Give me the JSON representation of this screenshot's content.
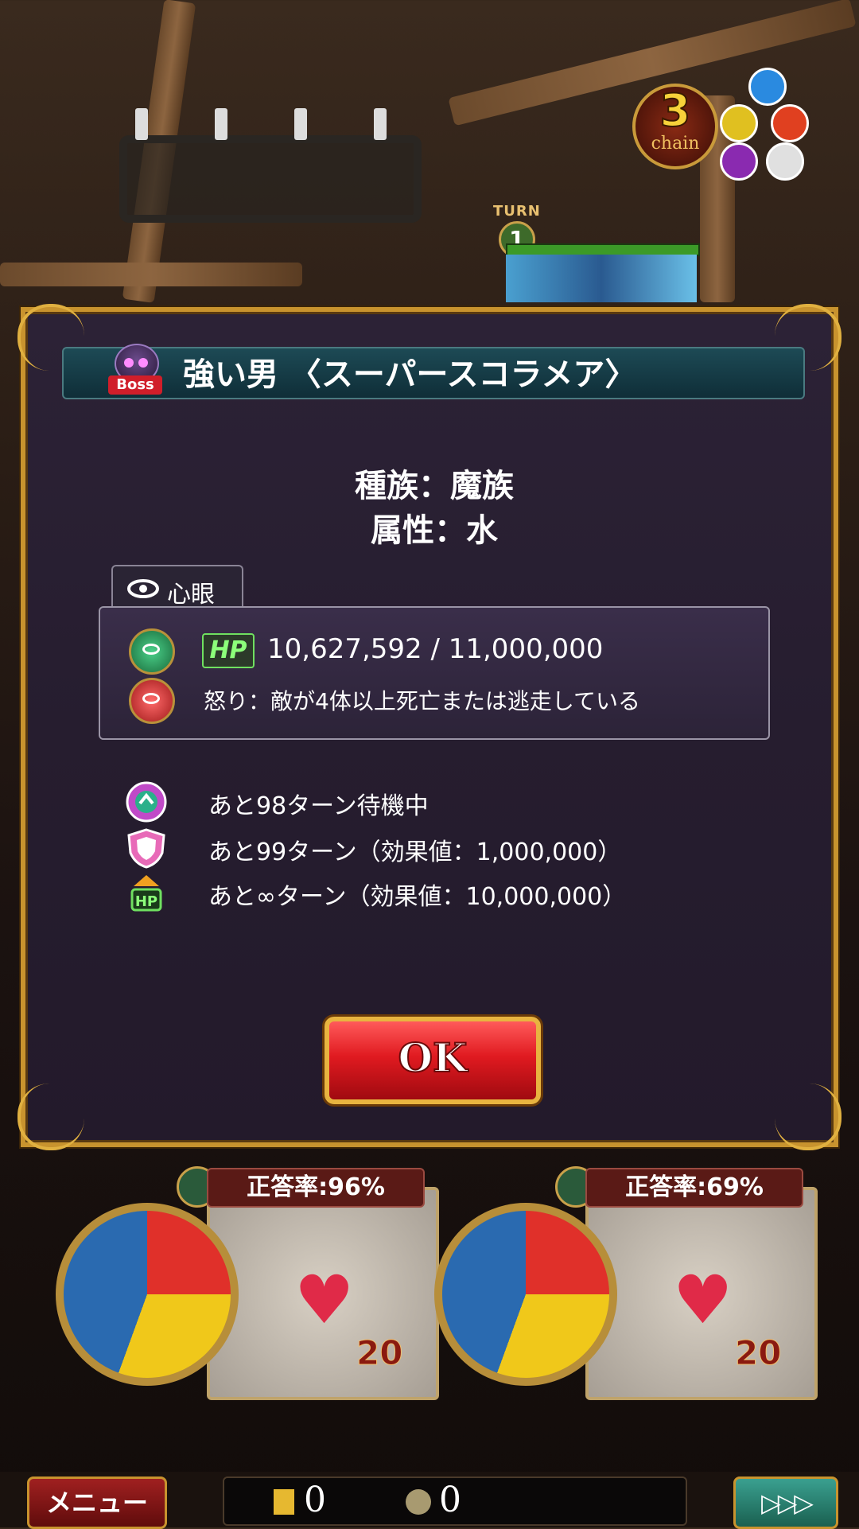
{
  "hud": {
    "chain_count": "3",
    "chain_label": "chain",
    "turn_label": "TURN",
    "turn_number": "1"
  },
  "dialog": {
    "boss_tag": "Boss",
    "title": "強い男 〈スーパースコラメア〉",
    "race": "種族：魔族",
    "attribute": "属性：水",
    "tab_label": "心眼",
    "hp_badge": "HP",
    "hp_text": "10,627,592 / 11,000,000",
    "rage_text": "怒り：敵が4体以上死亡または逃走している",
    "statuses": [
      {
        "icon": "swap-arrow-icon",
        "text": "あと98ターン待機中"
      },
      {
        "icon": "shield-icon",
        "text": "あと99ターン（効果値：1,000,000）"
      },
      {
        "icon": "hp-up-icon",
        "text": "あと∞ターン（効果値：10,000,000）"
      }
    ],
    "ok_label": "OK"
  },
  "cards": [
    {
      "rate": "正答率:96%",
      "hp": "20"
    },
    {
      "rate": "正答率:69%",
      "hp": "20"
    }
  ],
  "footer": {
    "menu_label": "メニュー",
    "gold_count": "0",
    "coin_count": "0",
    "forward_label": "▷▷▷"
  },
  "colors": {
    "frame_gold": "#c8932e",
    "ok_red": "#e01a20",
    "hp_green": "#8cff7a"
  }
}
